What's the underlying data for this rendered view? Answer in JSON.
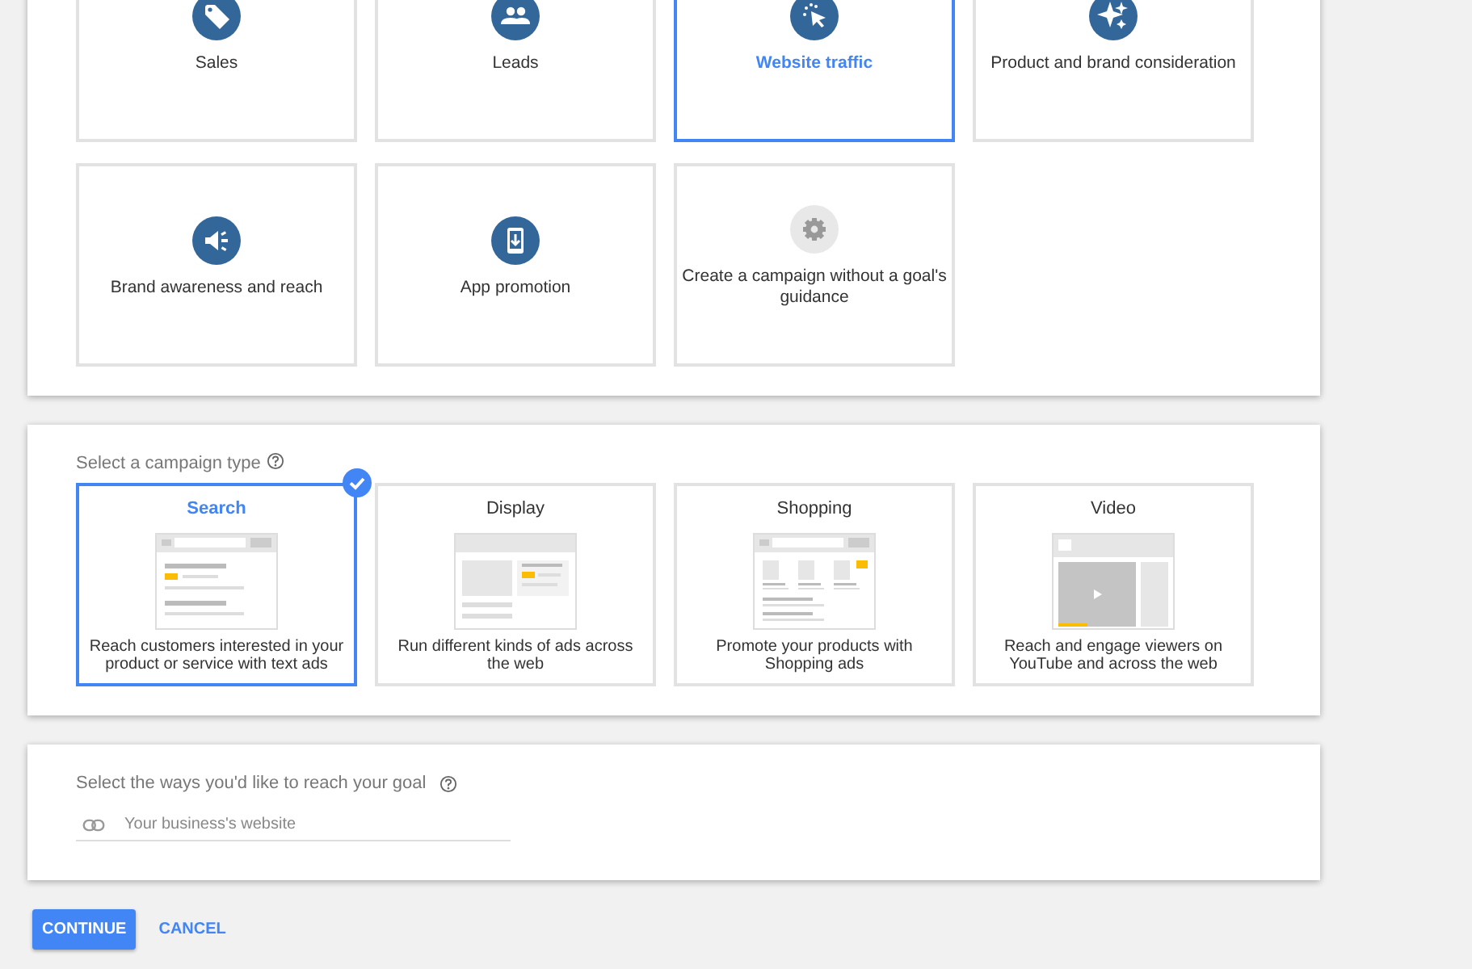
{
  "goals": [
    {
      "label": "Sales",
      "kind": "tag",
      "selected": false
    },
    {
      "label": "Leads",
      "kind": "people",
      "selected": false
    },
    {
      "label": "Website traffic",
      "kind": "cursor",
      "selected": true
    },
    {
      "label": "Product and brand consideration",
      "kind": "sparkle",
      "selected": false
    },
    {
      "label": "Brand awareness and reach",
      "kind": "megaphone",
      "selected": false
    },
    {
      "label": "App promotion",
      "kind": "phone",
      "selected": false
    },
    {
      "label": "Create a campaign without a goal's guidance",
      "kind": "gear",
      "selected": false
    }
  ],
  "campaign_type": {
    "label": "Select a campaign type",
    "types": [
      {
        "title": "Search",
        "kind": "search",
        "description": "Reach customers interested in your product or service with text ads",
        "selected": true
      },
      {
        "title": "Display",
        "kind": "display",
        "description": "Run different kinds of ads across the web",
        "selected": false
      },
      {
        "title": "Shopping",
        "kind": "shopping",
        "description": "Promote your products with Shopping ads",
        "selected": false
      },
      {
        "title": "Video",
        "kind": "video",
        "description": "Reach and engage viewers on YouTube and across the web",
        "selected": false
      }
    ]
  },
  "reach": {
    "label": "Select the ways you'd like to reach your goal",
    "field": {
      "placeholder": "Your business's website"
    }
  },
  "buttons": {
    "continue": "CONTINUE",
    "cancel": "CANCEL"
  }
}
